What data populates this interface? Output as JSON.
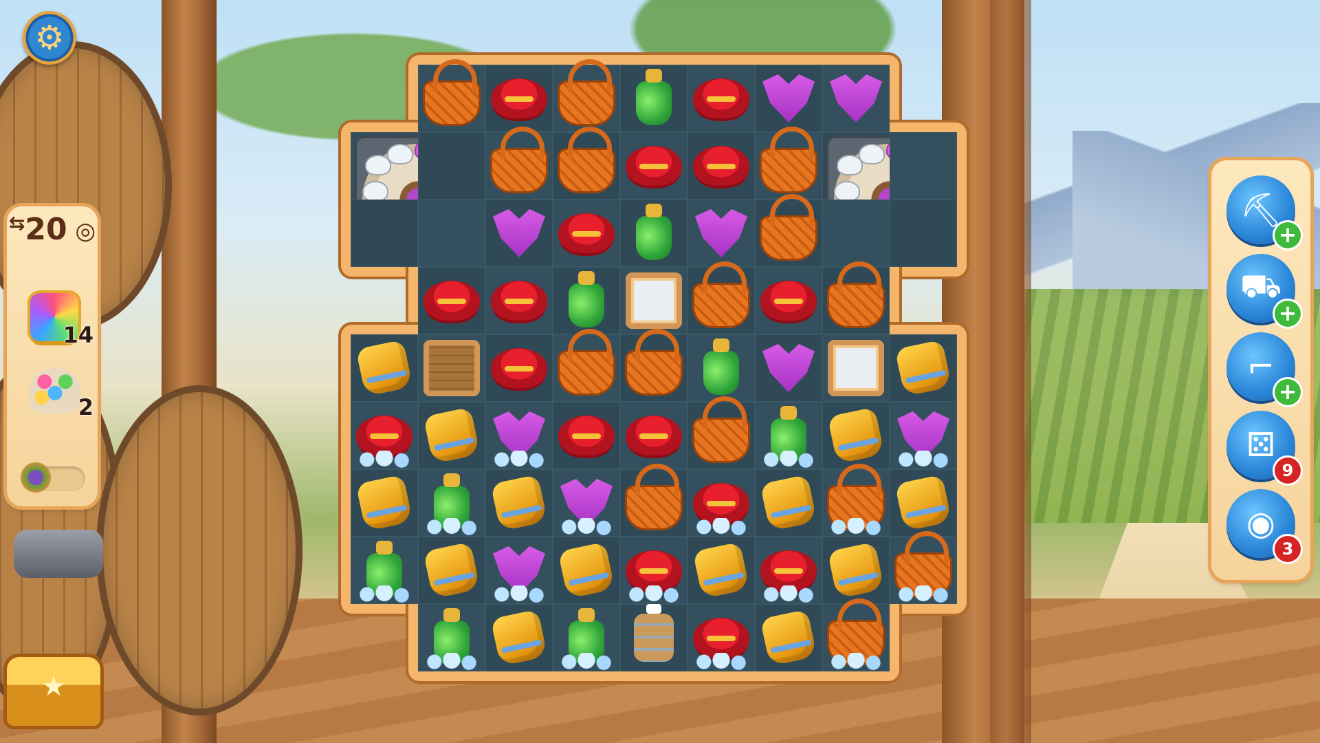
{
  "hud": {
    "moves_left": "20",
    "moves_arrow": "⇆"
  },
  "goals": [
    {
      "name": "rainbow-gem",
      "count": "14"
    },
    {
      "name": "mask-cake",
      "count": "2"
    }
  ],
  "progress": {
    "fraction": 0.0
  },
  "boosters": [
    {
      "name": "pickaxe",
      "badge": "+",
      "badge_type": "plus"
    },
    {
      "name": "wagon",
      "badge": "+",
      "badge_type": "plus"
    },
    {
      "name": "revolver",
      "badge": "+",
      "badge_type": "plus"
    },
    {
      "name": "dice",
      "badge": "9",
      "badge_type": "count"
    },
    {
      "name": "gold-coins",
      "badge": "3",
      "badge_type": "count"
    }
  ],
  "colors": {
    "panel": "#f6d39b",
    "panel_border": "#e7a55a",
    "board": "#2f4957",
    "booster_blue": "#2a86d8",
    "plus_green": "#3fba3a",
    "badge_red": "#d62323"
  },
  "board": {
    "rows": [
      [
        "-",
        "basket",
        "hat",
        "basket",
        "bottle",
        "hat",
        "scarf",
        "scarf",
        "-"
      ],
      [
        "wheel",
        "wheel",
        "basket",
        "basket",
        "hat",
        "hat",
        "basket",
        "wheel",
        "wheel"
      ],
      [
        "wheel",
        "wheel",
        "scarf",
        "hat",
        "bottle",
        "scarf",
        "basket",
        "wheel",
        "wheel"
      ],
      [
        "-",
        "hat",
        "hat",
        "bottle",
        "glass-crate",
        "basket",
        "hat",
        "basket",
        "-"
      ],
      [
        "bag",
        "wood-crate",
        "hat",
        "basket",
        "basket",
        "bottle",
        "scarf",
        "glass-crate",
        "bag"
      ],
      [
        "hat*",
        "bag",
        "scarf*",
        "hat",
        "hat",
        "basket",
        "bottle*",
        "bag",
        "scarf*"
      ],
      [
        "bag",
        "bottle*",
        "bag",
        "scarf*",
        "basket",
        "hat*",
        "bag",
        "basket*",
        "bag"
      ],
      [
        "bottle*",
        "bag",
        "scarf*",
        "bag",
        "hat*",
        "bag",
        "hat*",
        "bag",
        "basket*"
      ],
      [
        "-",
        "bottle*",
        "bag",
        "bottle*",
        "barrel",
        "hat*",
        "bag",
        "basket*",
        "-"
      ]
    ],
    "legend_note": "* = piece frozen in ice"
  }
}
